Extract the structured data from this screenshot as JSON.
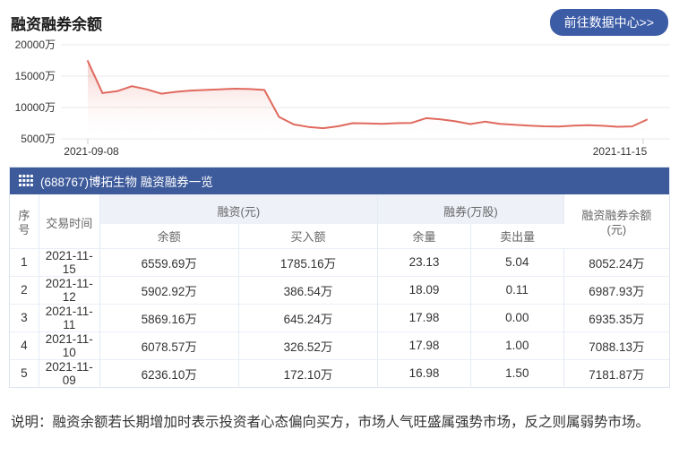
{
  "header": {
    "title": "融资融券余额",
    "button_label": "前往数据中心>>"
  },
  "colors": {
    "bar_blue": "#3d5a9b",
    "button_blue": "#3c5ca6",
    "line_red": "#e0695e",
    "grid_gray": "#e8e8e8",
    "group_header_bg": "#eef1f8"
  },
  "chart_data": {
    "type": "area",
    "title": "融资融券余额",
    "unit": "万",
    "ylim": [
      5000,
      20000
    ],
    "y_ticks": [
      {
        "label": "20000万",
        "value": 20000
      },
      {
        "label": "15000万",
        "value": 15000
      },
      {
        "label": "10000万",
        "value": 10000
      },
      {
        "label": "5000万",
        "value": 5000
      }
    ],
    "x_axis": {
      "start_label": "2021-09-08",
      "end_label": "2021-11-15"
    },
    "grid": "horizontal",
    "legend": "none",
    "line_color": "#e0695e",
    "values": [
      17400,
      12300,
      12600,
      13400,
      12900,
      12200,
      12500,
      12700,
      12800,
      12900,
      13000,
      12950,
      12800,
      8500,
      7300,
      6900,
      6700,
      7000,
      7500,
      7450,
      7400,
      7500,
      7550,
      8300,
      8100,
      7800,
      7350,
      7750,
      7400,
      7250,
      7100,
      7000,
      6950,
      7100,
      7182,
      7088,
      6935,
      6988,
      8052
    ]
  },
  "table": {
    "bar": {
      "icon": "table-grid-icon",
      "title": "(688767)博拓生物 融资融券一览"
    },
    "header": {
      "col_seq": "序号",
      "col_date": "交易时间",
      "group_rz": "融资(元)",
      "group_rq": "融券(万股)",
      "col_total_line1": "融资融券余额",
      "col_total_line2": "(元)",
      "sub_balance": "余额",
      "sub_buy": "买入额",
      "sub_qty": "余量",
      "sub_sell": "卖出量"
    },
    "rows": [
      {
        "seq": "1",
        "date": "2021-11-15",
        "rz_balance": "6559.69万",
        "rz_buy": "1785.16万",
        "rq_qty": "23.13",
        "rq_sell": "5.04",
        "total": "8052.24万"
      },
      {
        "seq": "2",
        "date": "2021-11-12",
        "rz_balance": "5902.92万",
        "rz_buy": "386.54万",
        "rq_qty": "18.09",
        "rq_sell": "0.11",
        "total": "6987.93万"
      },
      {
        "seq": "3",
        "date": "2021-11-11",
        "rz_balance": "5869.16万",
        "rz_buy": "645.24万",
        "rq_qty": "17.98",
        "rq_sell": "0.00",
        "total": "6935.35万"
      },
      {
        "seq": "4",
        "date": "2021-11-10",
        "rz_balance": "6078.57万",
        "rz_buy": "326.52万",
        "rq_qty": "17.98",
        "rq_sell": "1.00",
        "total": "7088.13万"
      },
      {
        "seq": "5",
        "date": "2021-11-09",
        "rz_balance": "6236.10万",
        "rz_buy": "172.10万",
        "rq_qty": "16.98",
        "rq_sell": "1.50",
        "total": "7181.87万"
      }
    ]
  },
  "note": "说明：融资余额若长期增加时表示投资者心态偏向买方，市场人气旺盛属强势市场，反之则属弱势市场。"
}
